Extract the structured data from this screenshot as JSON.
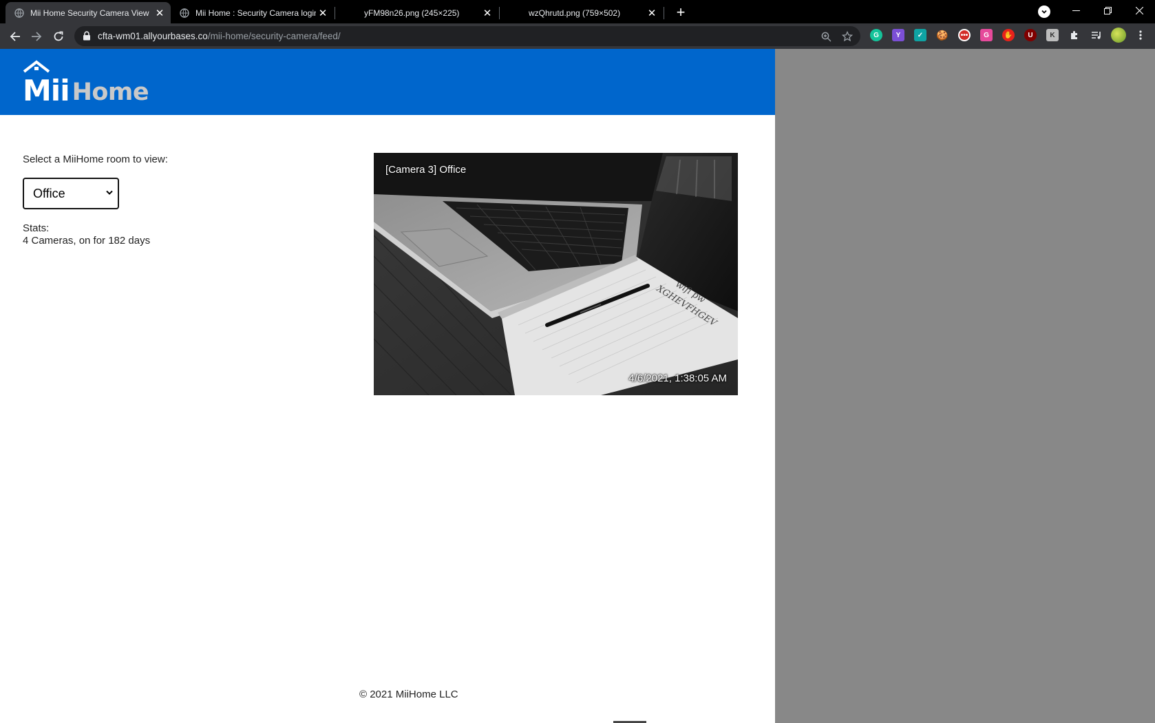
{
  "browser": {
    "tabs": [
      {
        "title": "Mii Home Security Camera View",
        "active": true
      },
      {
        "title": "Mii Home : Security Camera login",
        "active": false
      },
      {
        "title": "yFM98n26.png (245×225)",
        "active": false
      },
      {
        "title": "wzQhrutd.png (759×502)",
        "active": false
      }
    ],
    "url_host": "cfta-wm01.allyourbases.co",
    "url_path": "/mii-home/security-camera/feed/"
  },
  "brand": {
    "logo_mii": "Mii",
    "logo_home": "Home",
    "header_color": "#0066cc"
  },
  "room_selector": {
    "label": "Select a MiiHome room to view:",
    "selected": "Office"
  },
  "stats": {
    "label": "Stats:",
    "value": "4 Cameras, on for 182 days"
  },
  "camera": {
    "label": "[Camera 3] Office",
    "timestamp": "4/6/2021, 1:38:05 AM",
    "notepad_text_1": "wifi pw",
    "notepad_text_2": "XGHEVFHGEV"
  },
  "footer": {
    "copyright": "© 2021 MiiHome LLC"
  }
}
